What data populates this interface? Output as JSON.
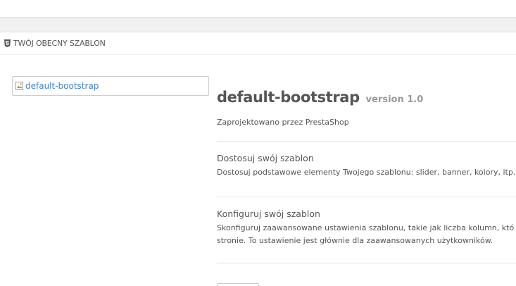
{
  "panel": {
    "heading": "TWÓJ OBECNY SZABLON",
    "heading_icon": "html5-icon"
  },
  "theme": {
    "preview_alt": "default-bootstrap",
    "name": "default-bootstrap",
    "version": "version 1.0",
    "designer": "Zaprojektowano przez PrestaShop"
  },
  "sections": [
    {
      "title": "Dostosuj swój szablon",
      "description": "Dostosuj podstawowe elementy Twojego szablonu: slider, banner, kolory, itp."
    },
    {
      "title": "Konfiguruj swój szablon",
      "description_line1": "Skonfiguruj zaawansowane ustawienia szablonu, takie jak liczba kolumn, któ",
      "description_line2": "stronie. To ustawienie jest głównie dla zaawansowanych użytkowników."
    }
  ],
  "colors": {
    "link": "#3f84c8",
    "text": "#555555",
    "muted": "#9a9a9a"
  }
}
